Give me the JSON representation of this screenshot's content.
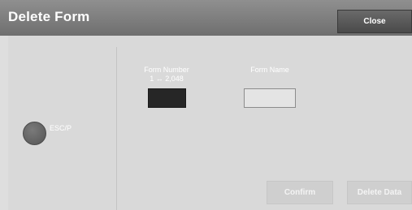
{
  "header": {
    "title": "Delete Form",
    "close_label": "Close"
  },
  "status": {
    "esc_label": "ESC/P"
  },
  "form_number": {
    "label": "Form Number",
    "range": "1 ↔ 2,048",
    "value": ""
  },
  "form_name": {
    "label": "Form Name",
    "value": ""
  },
  "actions": {
    "confirm_label": "Confirm",
    "delete_data_label": "Delete Data"
  },
  "colors": {
    "title_bar": "#7f7f7f",
    "background": "#dedede",
    "number_box": "#262626"
  }
}
